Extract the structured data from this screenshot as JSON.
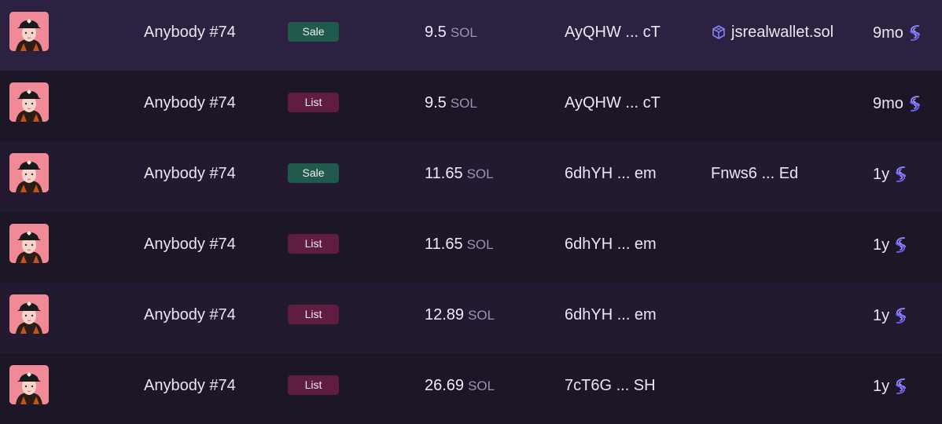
{
  "colors": {
    "sale_badge": "#1f5a4d",
    "list_badge": "#5e1d41",
    "row_odd": "#231a31",
    "row_even": "#1d1626",
    "accent_icon": "#8a82ff"
  },
  "rows": [
    {
      "name": "Anybody #74",
      "type": "Sale",
      "price": "9.5",
      "unit": "SOL",
      "seller": "AyQHW ... cT",
      "buyer": "jsrealwallet.sol",
      "buyer_icon": "cube-icon",
      "time": "9mo"
    },
    {
      "name": "Anybody #74",
      "type": "List",
      "price": "9.5",
      "unit": "SOL",
      "seller": "AyQHW ... cT",
      "buyer": "",
      "time": "9mo"
    },
    {
      "name": "Anybody #74",
      "type": "Sale",
      "price": "11.65",
      "unit": "SOL",
      "seller": "6dhYH ... em",
      "buyer": "Fnws6 ... Ed",
      "time": "1y"
    },
    {
      "name": "Anybody #74",
      "type": "List",
      "price": "11.65",
      "unit": "SOL",
      "seller": "6dhYH ... em",
      "buyer": "",
      "time": "1y"
    },
    {
      "name": "Anybody #74",
      "type": "List",
      "price": "12.89",
      "unit": "SOL",
      "seller": "6dhYH ... em",
      "buyer": "",
      "time": "1y"
    },
    {
      "name": "Anybody #74",
      "type": "List",
      "price": "26.69",
      "unit": "SOL",
      "seller": "7cT6G ... SH",
      "buyer": "",
      "time": "1y"
    }
  ]
}
